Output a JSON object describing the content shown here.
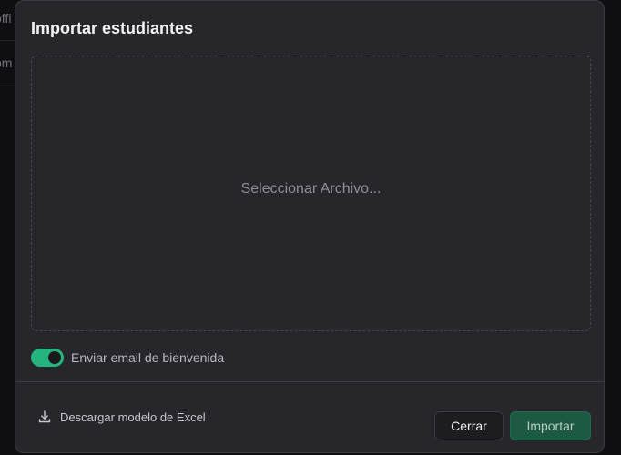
{
  "background": {
    "row_text_1": "offi",
    "row_text_2": "om"
  },
  "modal": {
    "title": "Importar estudiantes",
    "dropzone": {
      "label": "Seleccionar Archivo..."
    },
    "welcome_email": {
      "label": "Enviar email de bienvenida",
      "enabled": true
    },
    "footer": {
      "download_label": "Descargar modelo de Excel",
      "close_label": "Cerrar",
      "import_label": "Importar"
    }
  },
  "colors": {
    "accent": "#24b47e",
    "import_button": "#1c5a44",
    "modal_bg": "#27272b"
  }
}
